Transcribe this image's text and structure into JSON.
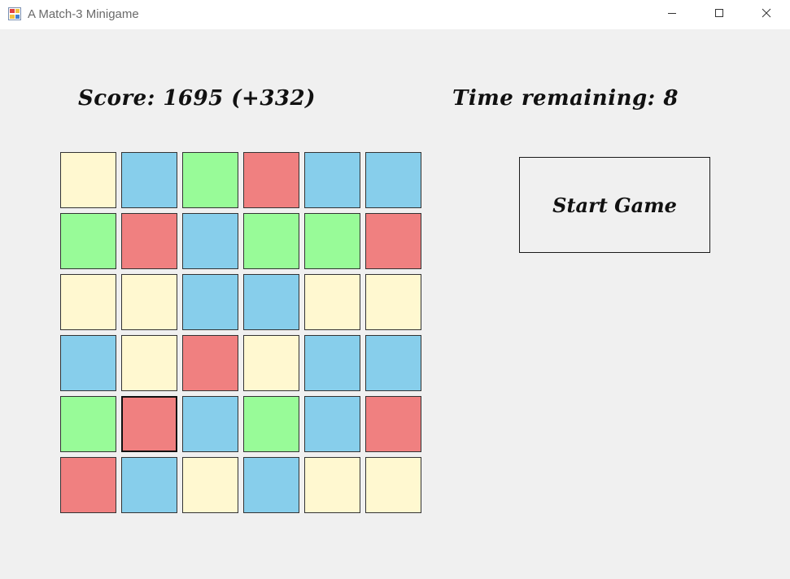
{
  "window": {
    "title": "A Match-3 Minigame"
  },
  "hud": {
    "score_text": "Score: 1695 (+332)",
    "time_text": "Time remaining: 8"
  },
  "controls": {
    "start_label": "Start Game"
  },
  "colors": {
    "yellow": "#fff8d0",
    "blue": "#87ceeb",
    "green": "#98fb98",
    "red": "#f08080",
    "background": "#f0f0f0"
  },
  "board": {
    "rows": 6,
    "cols": 6,
    "selected": [
      4,
      1
    ],
    "tiles": [
      [
        "yellow",
        "blue",
        "green",
        "red",
        "blue",
        "blue"
      ],
      [
        "green",
        "red",
        "blue",
        "green",
        "green",
        "red"
      ],
      [
        "yellow",
        "yellow",
        "blue",
        "blue",
        "yellow",
        "yellow"
      ],
      [
        "blue",
        "yellow",
        "red",
        "yellow",
        "blue",
        "blue"
      ],
      [
        "green",
        "red",
        "blue",
        "green",
        "blue",
        "red"
      ],
      [
        "red",
        "blue",
        "yellow",
        "blue",
        "yellow",
        "yellow"
      ]
    ]
  }
}
